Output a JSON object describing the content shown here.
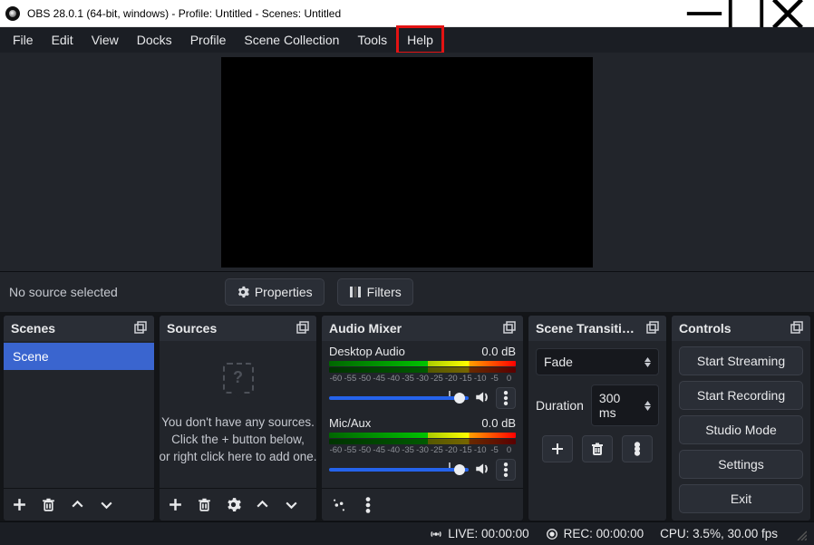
{
  "titlebar": {
    "title": "OBS 28.0.1 (64-bit, windows) - Profile: Untitled - Scenes: Untitled"
  },
  "menu": {
    "file": "File",
    "edit": "Edit",
    "view": "View",
    "docks": "Docks",
    "profile": "Profile",
    "scene_collection": "Scene Collection",
    "tools": "Tools",
    "help": "Help"
  },
  "midbar": {
    "no_source": "No source selected",
    "properties": "Properties",
    "filters": "Filters"
  },
  "docks": {
    "scenes": {
      "title": "Scenes",
      "items": [
        "Scene"
      ]
    },
    "sources": {
      "title": "Sources",
      "empty1": "You don't have any sources.",
      "empty2": "Click the + button below,",
      "empty3": "or right click here to add one."
    },
    "mixer": {
      "title": "Audio Mixer",
      "ch1_name": "Desktop Audio",
      "ch1_db": "0.0 dB",
      "ch2_name": "Mic/Aux",
      "ch2_db": "0.0 dB",
      "scale": [
        "-60",
        "-55",
        "-50",
        "-45",
        "-40",
        "-35",
        "-30",
        "-25",
        "-20",
        "-15",
        "-10",
        "-5",
        "0"
      ]
    },
    "transitions": {
      "title": "Scene Transiti…",
      "selected": "Fade",
      "duration_label": "Duration",
      "duration_value": "300 ms"
    },
    "controls": {
      "title": "Controls",
      "start_streaming": "Start Streaming",
      "start_recording": "Start Recording",
      "studio_mode": "Studio Mode",
      "settings": "Settings",
      "exit": "Exit"
    }
  },
  "status": {
    "live": "LIVE: 00:00:00",
    "rec": "REC: 00:00:00",
    "cpu": "CPU: 3.5%, 30.00 fps"
  }
}
